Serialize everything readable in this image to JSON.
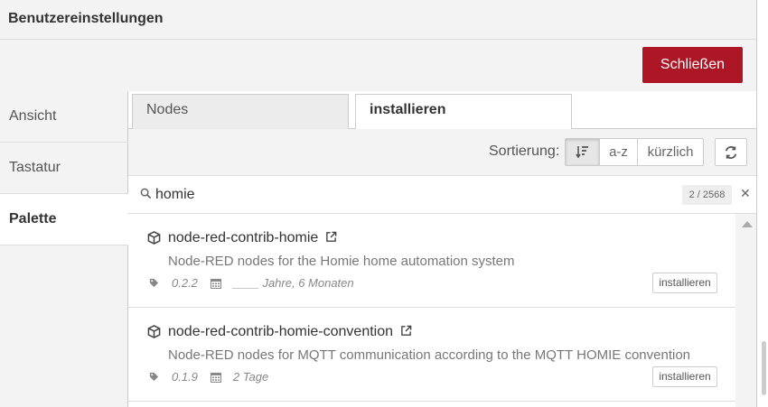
{
  "dialog": {
    "title": "Benutzereinstellungen",
    "close_label": "Schließen"
  },
  "nav": {
    "items": [
      {
        "label": "Ansicht",
        "active": false
      },
      {
        "label": "Tastatur",
        "active": false
      },
      {
        "label": "Palette",
        "active": true
      }
    ]
  },
  "tabs": [
    {
      "label": "Nodes",
      "active": false
    },
    {
      "label": "installieren",
      "active": true
    }
  ],
  "toolbar": {
    "sort_label": "Sortierung:",
    "sort_options": [
      {
        "label": "",
        "icon": "sort-relevance-icon",
        "selected": true
      },
      {
        "label": "a-z",
        "selected": false
      },
      {
        "label": "kürzlich",
        "selected": false
      }
    ],
    "refresh_icon": "refresh-icon"
  },
  "search": {
    "value": "homie",
    "count": "2 / 2568"
  },
  "results": [
    {
      "name": "node-red-contrib-homie",
      "description": "Node-RED nodes for the Homie home automation system",
      "version": "0.2.2",
      "updated": "____ Jahre, 6 Monaten",
      "action": "installieren"
    },
    {
      "name": "node-red-contrib-homie-convention",
      "description": "Node-RED nodes for MQTT communication according to the MQTT HOMIE convention",
      "version": "0.1.9",
      "updated": "2 Tage",
      "action": "installieren"
    }
  ],
  "colors": {
    "primary_button": "#ad1625",
    "panel_bg": "#f3f3f3",
    "border": "#cccccc"
  }
}
